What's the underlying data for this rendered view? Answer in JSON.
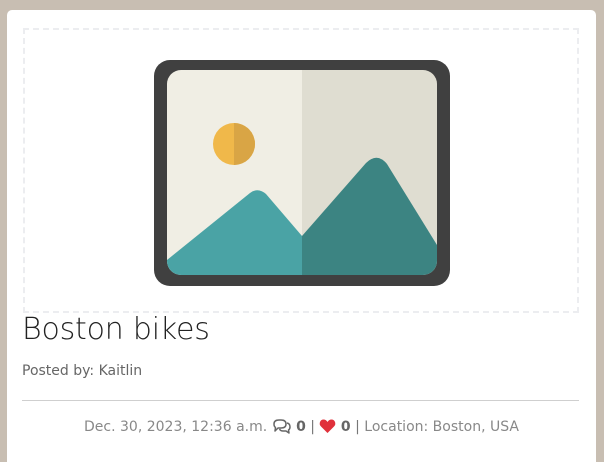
{
  "post": {
    "title": "Boston bikes",
    "posted_by": "Posted by: Kaitlin",
    "date": "Dec. 30, 2023, 12:36 a.m.",
    "comment_count": "0",
    "separator": "|",
    "like_count": "0",
    "location": "Location: Boston, USA"
  },
  "icons": {
    "image": "image-placeholder-icon",
    "comments": "comments-icon",
    "likes": "heart-icon"
  },
  "colors": {
    "page_background": "#c8beb2",
    "card_background": "#ffffff",
    "heart": "#e0313b",
    "placeholder_frame": "#404040",
    "placeholder_teal": "#4aa3a5",
    "placeholder_sun": "#f0b84a"
  }
}
